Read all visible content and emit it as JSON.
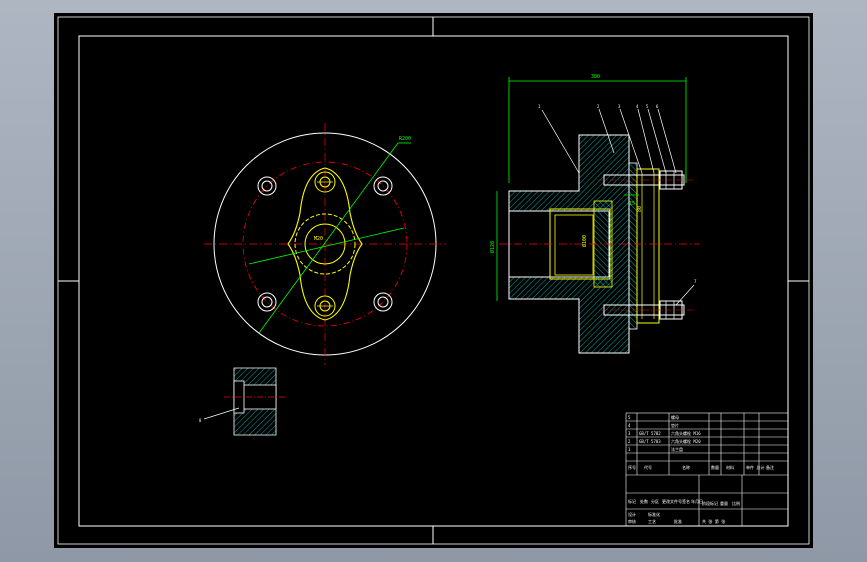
{
  "overall_width_dim": "380",
  "radius_dim": "R200",
  "center_label": "M20",
  "height_dim": "Ø120",
  "bore_dim": "Ø100",
  "depth_dim": "15",
  "side_callout": "80",
  "balloons": [
    "1",
    "2",
    "3",
    "4",
    "5",
    "6",
    "7",
    "8"
  ],
  "title_block": {
    "bom_rows": [
      {
        "no": "5",
        "code": "",
        "name": "螺母",
        "qty": "",
        "material": ""
      },
      {
        "no": "4",
        "code": "",
        "name": "垫片",
        "qty": "",
        "material": ""
      },
      {
        "no": "3",
        "code": "GB/T 5782",
        "name": "六角头螺栓 M16",
        "qty": "",
        "material": ""
      },
      {
        "no": "2",
        "code": "GB/T 5783",
        "name": "六角头螺栓 M20",
        "qty": "",
        "material": ""
      },
      {
        "no": "1",
        "code": "",
        "name": "法兰盘",
        "qty": "",
        "material": ""
      }
    ],
    "header": {
      "no": "序号",
      "code": "代号",
      "name": "名称",
      "qty": "数量",
      "material": "材料",
      "weight": "单件 总计",
      "remark": "备注"
    },
    "sign_row": [
      "标记",
      "处数",
      "分区",
      "更改文件号",
      "签名",
      "年月日"
    ],
    "stage_labels": [
      "阶段标记",
      "重量",
      "比例"
    ],
    "bottom_row": [
      "设计",
      "标准化",
      "审核",
      "工艺",
      "批准",
      "共 张 第 张"
    ]
  },
  "colors": {
    "frame": "#ffffff",
    "center": "#ff0000",
    "hatch": "#00cccc",
    "dim": "#00ff00",
    "part": "#ffff00",
    "background": "#000000"
  }
}
